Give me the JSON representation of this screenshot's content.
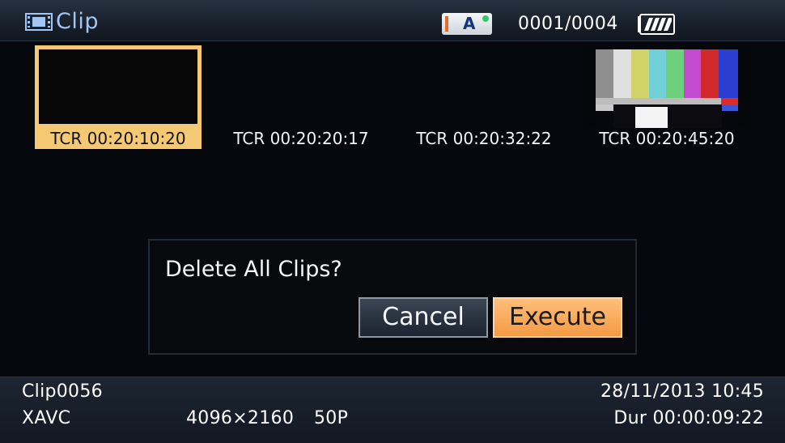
{
  "header": {
    "title": "Clip",
    "title_icon": "film-strip-icon",
    "media_slot": "A",
    "clip_counter": "0001/0004",
    "battery_icon": "battery-full-icon",
    "title_color": "#9fc6f4"
  },
  "thumbnails": [
    {
      "timecode": "TCR 00:20:10:20",
      "selected": true,
      "content": "black"
    },
    {
      "timecode": "TCR 00:20:20:17",
      "selected": false,
      "content": "black"
    },
    {
      "timecode": "TCR 00:20:32:22",
      "selected": false,
      "content": "black"
    },
    {
      "timecode": "TCR 00:20:45:20",
      "selected": false,
      "content": "color-bars"
    }
  ],
  "dialog": {
    "message": "Delete All Clips?",
    "cancel_label": "Cancel",
    "execute_label": "Execute"
  },
  "footer": {
    "clip_name": "Clip0056",
    "format": "XAVC",
    "resolution": "4096×2160",
    "frame_rate": "50P",
    "datetime": "28/11/2013 10:45",
    "duration": "Dur 00:00:09:22"
  },
  "colors": {
    "selection_accent": "#f5c874",
    "execute_button": "#f39a45"
  }
}
